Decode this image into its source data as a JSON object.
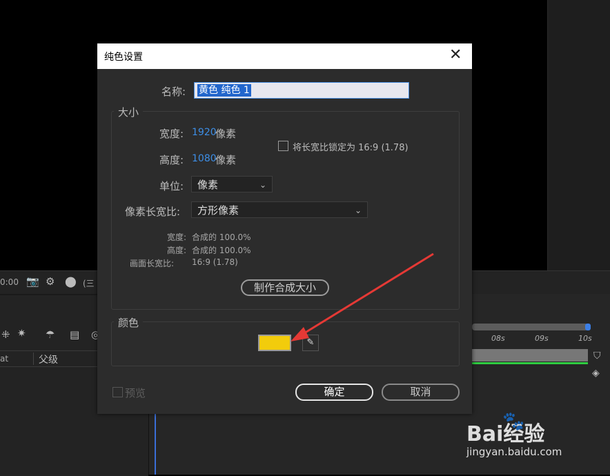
{
  "background": {
    "timeline_ticks": [
      "08s",
      "09s",
      "10s"
    ],
    "parent_column": "父级",
    "left_column_fragment": "at",
    "time_fragment": "0:00",
    "toolbar_bracket": "(三"
  },
  "dialog": {
    "title": "纯色设置",
    "close_glyph": "✕",
    "name_label": "名称:",
    "name_value": "黄色 纯色 1",
    "size_section": "大小",
    "width_label": "宽度:",
    "width_value": "1920",
    "height_label": "高度:",
    "height_value": "1080",
    "pixel_unit": "像素",
    "lock_aspect_label": "将长宽比锁定为 16:9 (1.78)",
    "unit_label": "单位:",
    "unit_value": "像素",
    "pixel_aspect_label": "像素长宽比:",
    "pixel_aspect_value": "方形像素",
    "info_width_label": "宽度:",
    "info_width_value": "合成的 100.0%",
    "info_height_label": "高度:",
    "info_height_value": "合成的 100.0%",
    "frame_aspect_label": "画面长宽比:",
    "frame_aspect_value": "16:9 (1.78)",
    "make_comp_size": "制作合成大小",
    "color_section": "颜色",
    "color_value": "#f2cc0c",
    "preview_label": "预览",
    "ok": "确定",
    "cancel": "取消"
  },
  "watermark": {
    "brand": "Bai经验",
    "url": "jingyan.baidu.com"
  },
  "colors": {
    "accent_blue": "#3d8ee6",
    "arrow_red": "#e53935"
  }
}
